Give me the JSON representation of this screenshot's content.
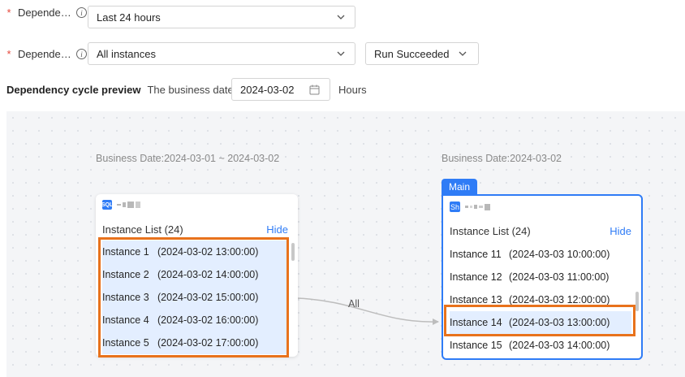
{
  "form": {
    "row1": {
      "required_mark": "*",
      "label": "Depende…",
      "select_value": "Last 24 hours"
    },
    "row2": {
      "required_mark": "*",
      "label": "Depende…",
      "select_value": "All instances",
      "status_value": "Run Succeeded"
    },
    "preview": {
      "title": "Dependency cycle preview",
      "business_date_text": "The business date is",
      "date_value": "2024-03-02",
      "unit": "Hours"
    }
  },
  "graph": {
    "edge_label": "All",
    "left_node": {
      "business_date": "Business Date:2024-03-01 ~ 2024-03-02",
      "type_badge": "SQL",
      "list_title": "Instance List (24)",
      "hide_label": "Hide",
      "instances": [
        {
          "name": "Instance 1",
          "time": "(2024-03-02 13:00:00)"
        },
        {
          "name": "Instance 2",
          "time": "(2024-03-02 14:00:00)"
        },
        {
          "name": "Instance 3",
          "time": "(2024-03-02 15:00:00)"
        },
        {
          "name": "Instance 4",
          "time": "(2024-03-02 16:00:00)"
        },
        {
          "name": "Instance 5",
          "time": "(2024-03-02 17:00:00)"
        }
      ]
    },
    "right_node": {
      "business_date": "Business Date:2024-03-02",
      "main_tag": "Main",
      "type_badge": "Sh",
      "list_title": "Instance List (24)",
      "hide_label": "Hide",
      "instances": [
        {
          "name": "Instance 11",
          "time": "(2024-03-03 10:00:00)"
        },
        {
          "name": "Instance 12",
          "time": "(2024-03-03 11:00:00)"
        },
        {
          "name": "Instance 13",
          "time": "(2024-03-03 12:00:00)"
        },
        {
          "name": "Instance 14",
          "time": "(2024-03-03 13:00:00)"
        },
        {
          "name": "Instance 15",
          "time": "(2024-03-03 14:00:00)"
        }
      ]
    }
  },
  "colors": {
    "accent": "#2f7cf6",
    "highlight": "#e8721c",
    "selected_bg": "#e3eeff",
    "required": "#e5483c"
  }
}
